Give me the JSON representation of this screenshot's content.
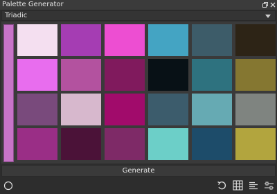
{
  "window": {
    "title": "Palette Generator"
  },
  "dropdown": {
    "selected": "Triadic"
  },
  "selected_color": "#c774c8",
  "swatches": [
    [
      "#f4dff0",
      "#a53db3",
      "#ed4ed2",
      "#44a4c3",
      "#3d5c69",
      "#2d2416"
    ],
    [
      "#e86dee",
      "#b3529f",
      "#801a5d",
      "#081116",
      "#2e727f",
      "#857731"
    ],
    [
      "#794a7c",
      "#d7b8cd",
      "#a10b6b",
      "#3c5c6c",
      "#66aab3",
      "#7f8480"
    ],
    [
      "#9a2e86",
      "#4b1238",
      "#7e2a67",
      "#6ccfc8",
      "#1d4c6a",
      "#b2a53e"
    ]
  ],
  "generate": {
    "label": "Generate"
  },
  "icons": {
    "float": "float-icon",
    "close": "close-icon",
    "mode": "circle-icon",
    "undo": "undo-icon",
    "grid": "grid-icon",
    "list": "list-icon",
    "settings": "settings-icon"
  }
}
